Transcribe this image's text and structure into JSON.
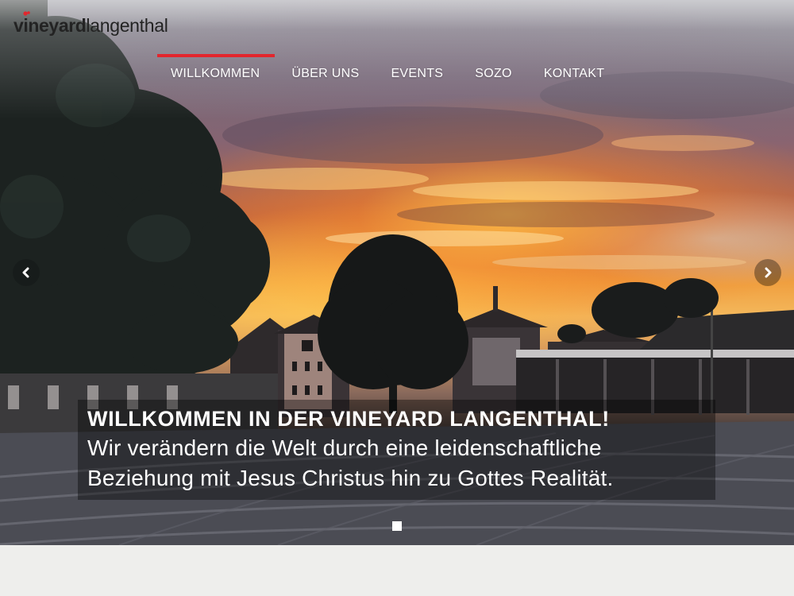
{
  "header": {
    "logo_bold": "vineyard",
    "logo_light": "langenthal",
    "accent_color": "#e3262d"
  },
  "nav": {
    "items": [
      {
        "label": "WILLKOMMEN",
        "active": true
      },
      {
        "label": "ÜBER UNS",
        "active": false
      },
      {
        "label": "EVENTS",
        "active": false
      },
      {
        "label": "SOZO",
        "active": false
      },
      {
        "label": "KONTAKT",
        "active": false
      }
    ]
  },
  "slider": {
    "prev_icon": "chevron-left-icon",
    "next_icon": "chevron-right-icon",
    "caption": {
      "headline": "WILLKOMMEN IN DER VINEYARD LANGENTHAL!",
      "line1": "Wir verändern die Welt durch eine leidenschaftliche",
      "line2": "Beziehung mit Jesus Christus hin zu Gottes Realität."
    },
    "slide_count": 1,
    "current_slide": 1
  }
}
